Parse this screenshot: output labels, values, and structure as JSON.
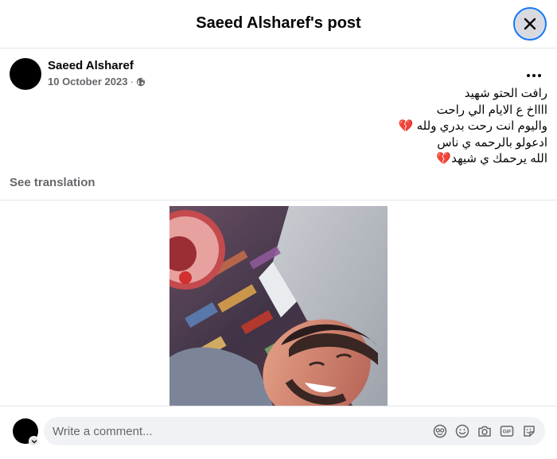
{
  "header": {
    "title": "Saeed Alsharef's post"
  },
  "post": {
    "author": "Saeed Alsharef",
    "date": "10 October 2023",
    "separator": "·",
    "audience_icon": "globe-icon",
    "more_icon": "more-options-icon",
    "text_lines": [
      "رافت الحتو شهيد",
      "ااااخ ع الايام الي راحت",
      "واليوم انت رحت بدري ولله 💔",
      "ادعولو بالرحمه ي ناس",
      "الله يرحمك ي شيهد💔"
    ],
    "see_translation": "See translation"
  },
  "composer": {
    "placeholder": "Write a comment...",
    "icons": [
      "avatar-sticker-icon",
      "emoji-icon",
      "camera-icon",
      "gif-icon",
      "sticker-icon"
    ]
  },
  "colors": {
    "accent": "#1877f2",
    "secondary_text": "#65676b",
    "input_bg": "#f0f2f5",
    "divider": "#e4e6eb"
  }
}
